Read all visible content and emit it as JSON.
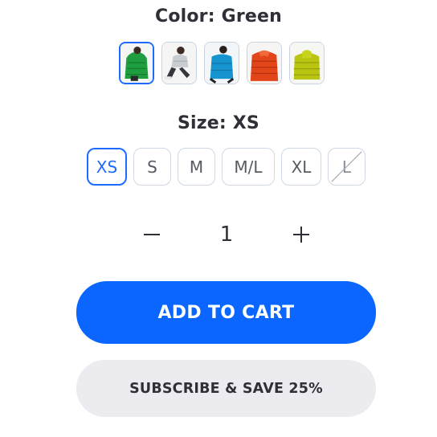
{
  "color": {
    "label": "Color: Green",
    "options": [
      {
        "icon": "green-puffer-jacket-thumbnail",
        "selected": true
      },
      {
        "icon": "gray-puffer-jacket-thumbnail",
        "selected": false
      },
      {
        "icon": "blue-puffer-jacket-thumbnail",
        "selected": false
      },
      {
        "icon": "red-puffer-jacket-thumbnail",
        "selected": false
      },
      {
        "icon": "lime-puffer-jacket-thumbnail",
        "selected": false
      }
    ]
  },
  "size": {
    "label": "Size: XS",
    "options": [
      {
        "label": "XS",
        "selected": true,
        "available": true
      },
      {
        "label": "S",
        "selected": false,
        "available": true
      },
      {
        "label": "M",
        "selected": false,
        "available": true
      },
      {
        "label": "M/L",
        "selected": false,
        "available": true
      },
      {
        "label": "XL",
        "selected": false,
        "available": true
      },
      {
        "label": "L",
        "selected": false,
        "available": false
      }
    ]
  },
  "quantity": {
    "value": "1",
    "decrement_icon": "minus-icon",
    "increment_icon": "plus-icon"
  },
  "actions": {
    "add_to_cart": "ADD TO CART",
    "subscribe": "SUBSCRIBE & SAVE 25%"
  },
  "colors": {
    "accent": "#0a66ff",
    "selected_border": "#1f6bff",
    "secondary_button_bg": "#ebebf0"
  }
}
